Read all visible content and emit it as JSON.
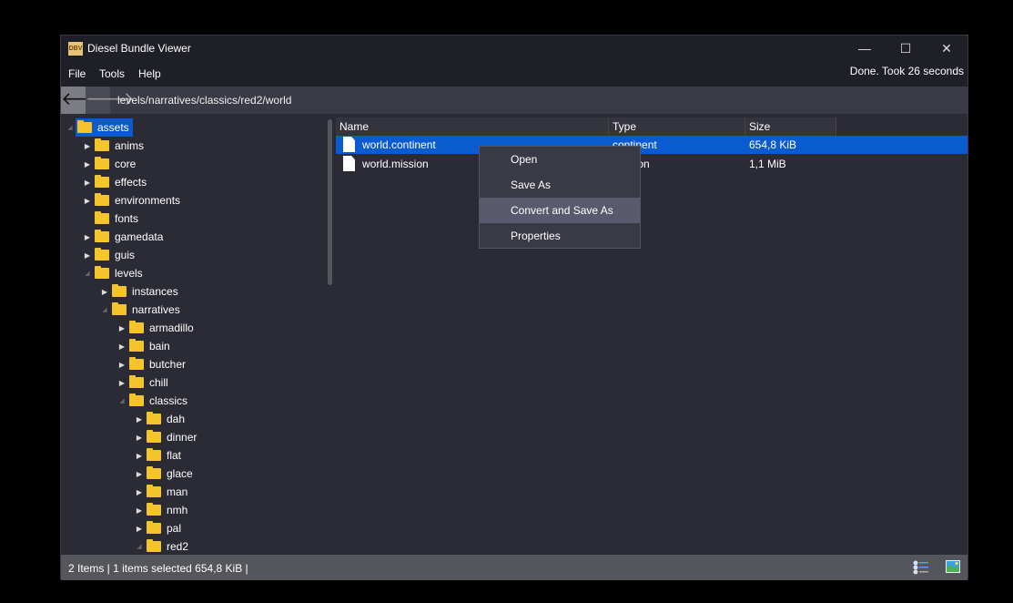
{
  "window": {
    "title": "Diesel Bundle Viewer",
    "logo": "DBV",
    "minimize": "—",
    "maximize": "☐",
    "close": "✕"
  },
  "menu": [
    "File",
    "Tools",
    "Help"
  ],
  "status_top": "Done. Took 26 seconds",
  "address": {
    "back": "🡐",
    "forward": "🡒",
    "path": "levels/narratives/classics/red2/world"
  },
  "tree": [
    {
      "label": "assets",
      "level": 0,
      "state": "open",
      "selected": true
    },
    {
      "label": "anims",
      "level": 1,
      "state": "closed"
    },
    {
      "label": "core",
      "level": 1,
      "state": "closed"
    },
    {
      "label": "effects",
      "level": 1,
      "state": "closed"
    },
    {
      "label": "environments",
      "level": 1,
      "state": "closed"
    },
    {
      "label": "fonts",
      "level": 1,
      "state": "none"
    },
    {
      "label": "gamedata",
      "level": 1,
      "state": "closed"
    },
    {
      "label": "guis",
      "level": 1,
      "state": "closed"
    },
    {
      "label": "levels",
      "level": 1,
      "state": "open"
    },
    {
      "label": "instances",
      "level": 2,
      "state": "closed"
    },
    {
      "label": "narratives",
      "level": 2,
      "state": "open"
    },
    {
      "label": "armadillo",
      "level": 3,
      "state": "closed"
    },
    {
      "label": "bain",
      "level": 3,
      "state": "closed"
    },
    {
      "label": "butcher",
      "level": 3,
      "state": "closed"
    },
    {
      "label": "chill",
      "level": 3,
      "state": "closed"
    },
    {
      "label": "classics",
      "level": 3,
      "state": "open"
    },
    {
      "label": "dah",
      "level": 4,
      "state": "closed"
    },
    {
      "label": "dinner",
      "level": 4,
      "state": "closed"
    },
    {
      "label": "flat",
      "level": 4,
      "state": "closed"
    },
    {
      "label": "glace",
      "level": 4,
      "state": "closed"
    },
    {
      "label": "man",
      "level": 4,
      "state": "closed"
    },
    {
      "label": "nmh",
      "level": 4,
      "state": "closed"
    },
    {
      "label": "pal",
      "level": 4,
      "state": "closed"
    },
    {
      "label": "red2",
      "level": 4,
      "state": "open"
    }
  ],
  "list": {
    "columns": [
      "Name",
      "Type",
      "Size"
    ],
    "rows": [
      {
        "name": "world.continent",
        "type": "continent",
        "size": "654,8 KiB",
        "selected": true
      },
      {
        "name": "world.mission",
        "type": "mission",
        "size": "1,1 MiB"
      }
    ]
  },
  "context_menu": {
    "items": [
      "Open",
      "Save As",
      "Convert and Save As",
      "Properties"
    ],
    "highlighted": 2
  },
  "statusbar": {
    "text": "2 Items | 1 items selected 654,8 KiB |",
    "icons": [
      "list-view-icon",
      "image-view-icon"
    ]
  }
}
